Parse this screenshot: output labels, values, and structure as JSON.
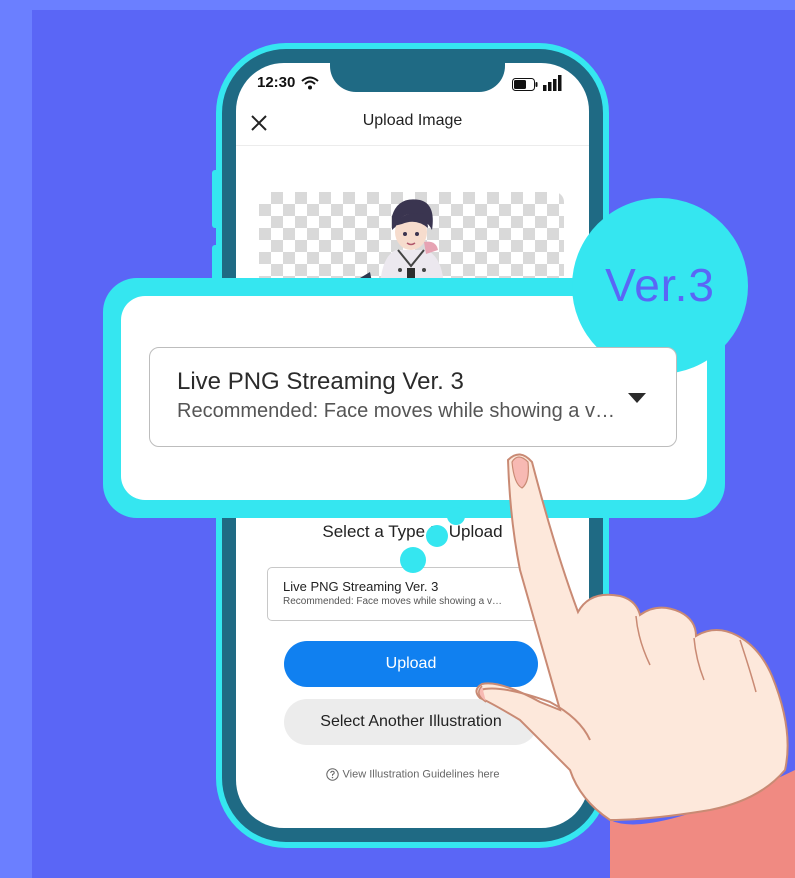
{
  "status_bar": {
    "time": "12:30"
  },
  "header": {
    "title": "Upload Image"
  },
  "main": {
    "section_title": "Select a Type to Upload",
    "select": {
      "value": "Live PNG Streaming Ver. 3",
      "description": "Recommended: Face moves while showing a v…"
    },
    "upload_button": "Upload",
    "another_button": "Select Another Illustration",
    "guidelines_link": "View Illustration Guidelines here"
  },
  "callout": {
    "badge": "Ver.3",
    "select_value": "Live PNG Streaming Ver. 3",
    "select_description": "Recommended: Face moves while showing a v…"
  },
  "colors": {
    "background": "#5a66f6",
    "accent_cyan": "#35e6f0",
    "primary_button": "#1080f0",
    "secondary_button": "#ececec"
  }
}
